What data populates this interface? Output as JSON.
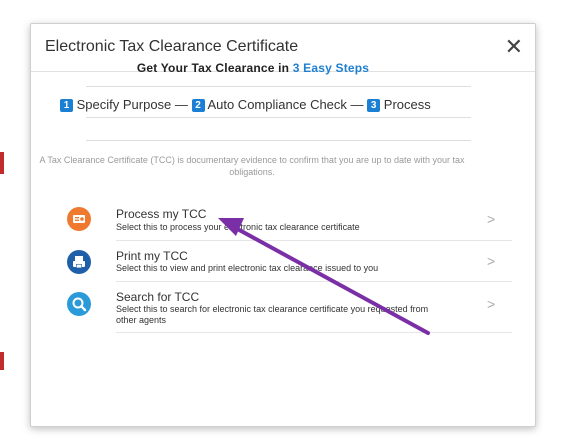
{
  "dialog": {
    "title": "Electronic Tax Clearance Certificate",
    "close_label": "✕"
  },
  "headline": {
    "text": "Get Your Tax Clearance in ",
    "accent": "3 Easy Steps"
  },
  "steps": [
    {
      "num": "1",
      "label": "Specify Purpose"
    },
    {
      "num": "2",
      "label": "Auto Compliance Check"
    },
    {
      "num": "3",
      "label": "Process"
    }
  ],
  "separator": "—",
  "description": "A Tax Clearance Certificate (TCC) is documentary evidence to confirm that you are up to date with your tax obligations.",
  "options": [
    {
      "title": "Process my TCC",
      "subtitle": "Select this to process your electronic tax clearance certificate",
      "icon": "certificate-icon",
      "color": "#ef7a2f"
    },
    {
      "title": "Print my TCC",
      "subtitle": "Select this to view and print electronic tax clearance issued to you",
      "icon": "print-document-icon",
      "color": "#1f5fa8"
    },
    {
      "title": "Search for TCC",
      "subtitle": "Select this to search for electronic tax clearance certificate you requested from other agents",
      "icon": "search-icon",
      "color": "#2b9ad8"
    }
  ],
  "chevron": ">",
  "annotation_color": "#7b2fa6"
}
